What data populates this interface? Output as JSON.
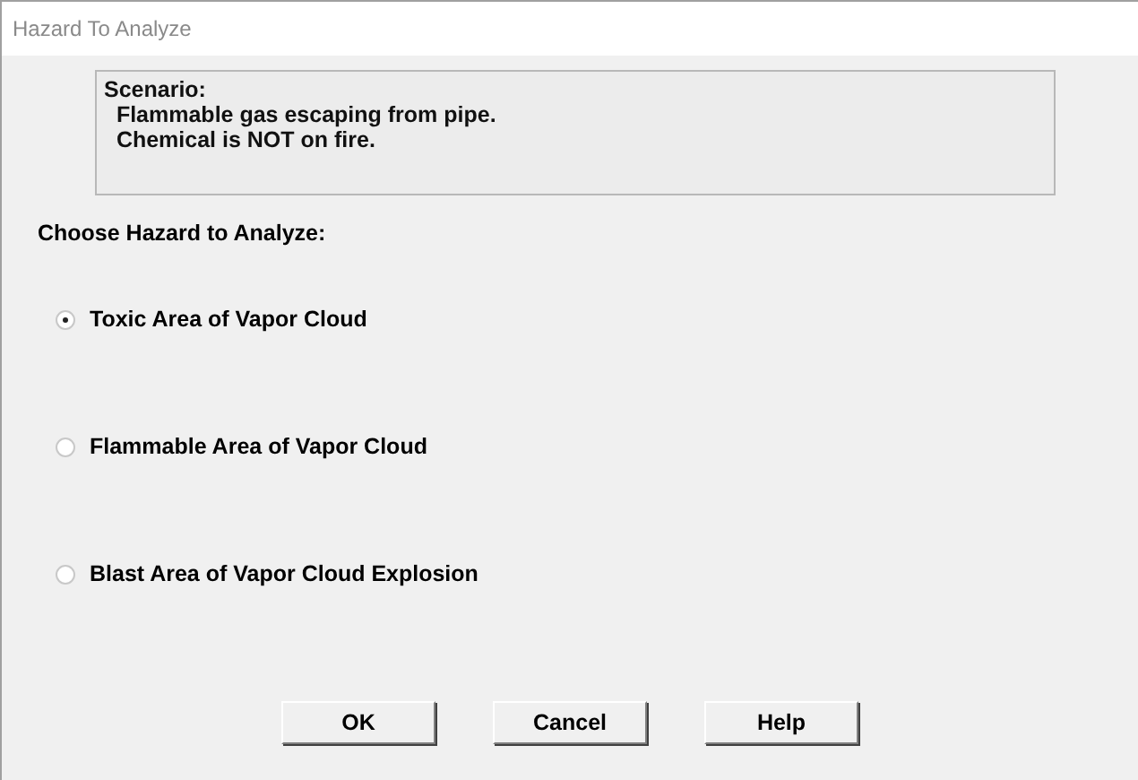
{
  "window": {
    "title": "Hazard To Analyze"
  },
  "scenario": {
    "lines": [
      "Scenario:",
      "  Flammable gas escaping from pipe.",
      "  Chemical is NOT on fire."
    ]
  },
  "prompt": "Choose Hazard to Analyze:",
  "options": [
    {
      "label": "Toxic Area of Vapor Cloud",
      "selected": true
    },
    {
      "label": "Flammable Area of Vapor Cloud",
      "selected": false
    },
    {
      "label": "Blast Area of Vapor Cloud Explosion",
      "selected": false
    }
  ],
  "buttons": [
    "OK",
    "Cancel",
    "Help"
  ]
}
